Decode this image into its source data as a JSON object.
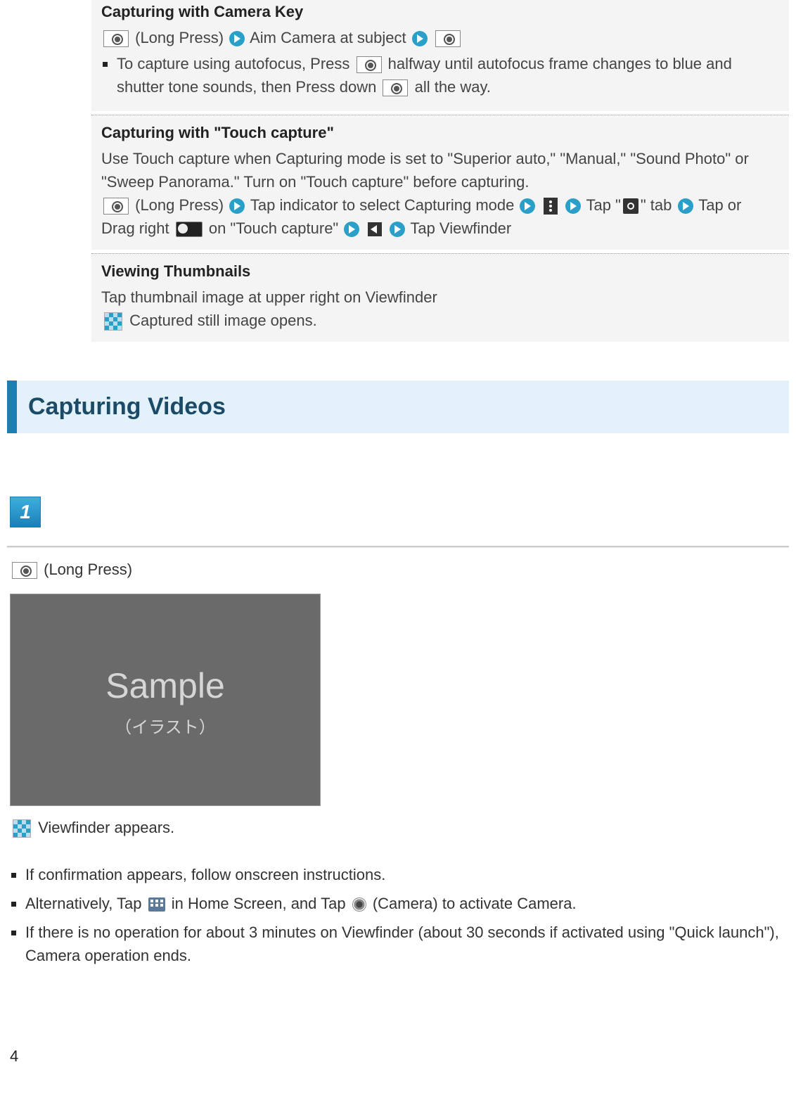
{
  "box1": {
    "title": "Capturing with Camera Key",
    "line1a": " (Long Press)",
    "line1b": " Aim Camera at subject",
    "bullet1a": "To capture using autofocus, Press ",
    "bullet1b": " halfway until autofocus frame changes to blue and shutter tone sounds, then Press down ",
    "bullet1c": " all the way."
  },
  "box2": {
    "title": "Capturing with \"Touch capture\"",
    "intro": "Use Touch capture when Capturing mode is set to \"Superior auto,\" \"Manual,\" \"Sound Photo\" or \"Sweep Panorama.\" Turn on \"Touch capture\" before capturing.",
    "s1": " (Long Press)",
    "s2": " Tap indicator to select Capturing mode",
    "s3": " Tap \"",
    "s3b": "\" tab",
    "s4": "Tap or Drag right ",
    "s5": " on \"Touch capture\"",
    "s6": " Tap Viewfinder"
  },
  "box3": {
    "title": "Viewing Thumbnails",
    "line1": "Tap thumbnail image at upper right on Viewfinder",
    "line2": " Captured still image opens."
  },
  "section": {
    "heading": "Capturing Videos"
  },
  "step": {
    "num": "1",
    "text": " (Long Press)",
    "sample1": "Sample",
    "sample2": "（イラスト）",
    "result": "Viewfinder appears."
  },
  "notes": {
    "n1": "If confirmation appears, follow onscreen instructions.",
    "n2a": "Alternatively, Tap ",
    "n2b": " in Home Screen, and Tap ",
    "n2c": " (Camera) to activate Camera.",
    "n3": "If there is no operation for about 3 minutes on Viewfinder (about 30 seconds if activated using \"Quick launch\"), Camera operation ends."
  },
  "pageNumber": "4"
}
